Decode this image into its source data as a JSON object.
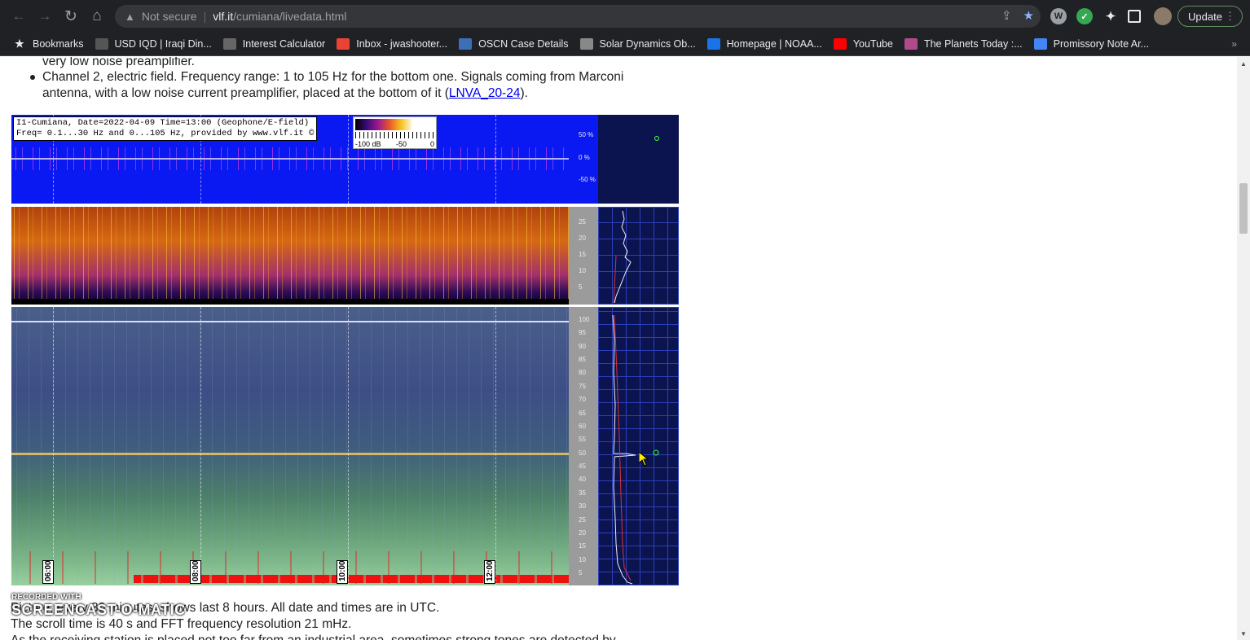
{
  "browser": {
    "nav": {
      "back": "←",
      "forward": "→",
      "reload": "↻",
      "home": "⌂"
    },
    "omnibox": {
      "security": "Not secure",
      "host": "vlf.it",
      "path": "/cumiana/livedata.html"
    },
    "update_label": "Update",
    "bookmarks": [
      {
        "label": "Bookmarks",
        "icon": "star-icon",
        "color": "#e8eaed"
      },
      {
        "label": "USD IQD | Iraqi Din...",
        "icon": "inv-icon",
        "color": "#555"
      },
      {
        "label": "Interest Calculator",
        "icon": "calculator-icon",
        "color": "#666"
      },
      {
        "label": "Inbox - jwashooter...",
        "icon": "gmail-icon",
        "color": "#ea4335"
      },
      {
        "label": "OSCN Case Details",
        "icon": "shield-icon",
        "color": "#3b6fb6"
      },
      {
        "label": "Solar Dynamics Ob...",
        "icon": "sdo-icon",
        "color": "#888"
      },
      {
        "label": "Homepage | NOAA...",
        "icon": "noaa-icon",
        "color": "#1a73e8"
      },
      {
        "label": "YouTube",
        "icon": "youtube-icon",
        "color": "#ff0000"
      },
      {
        "label": "The Planets Today :...",
        "icon": "planets-icon",
        "color": "#b04a8a"
      },
      {
        "label": "Promissory Note Ar...",
        "icon": "document-icon",
        "color": "#4285f4"
      }
    ]
  },
  "content": {
    "line_top": "very low noise preamplifier.",
    "bullet_line1": "Channel 2, electric field. Frequency range: 1 to 105 Hz for the bottom one. Signals coming from Marconi",
    "bullet_line2_pre": "antenna, with a low noise current preamplifier, placed at the bottom of it  (",
    "bullet_link": "LNVA_20-24",
    "bullet_line2_post": ").",
    "figure": {
      "info_line1": "I1-Cumiana, Date=2022-04-09 Time=13:00 (Geophone/E-field)",
      "info_line2": "Freq= 0.1...30 Hz and 0...105 Hz, provided by www.vlf.it ©",
      "scale_labels": [
        "-100 dB",
        "-50",
        "0"
      ],
      "wave_ticks": [
        "50 %",
        "0 %",
        "-50 %"
      ],
      "spec1_ticks": [
        "25",
        "20",
        "15",
        "10",
        "5"
      ],
      "spec2_ticks": [
        "100",
        "95",
        "90",
        "85",
        "80",
        "75",
        "70",
        "65",
        "60",
        "55",
        "50",
        "45",
        "40",
        "35",
        "30",
        "25",
        "20",
        "15",
        "10",
        "5"
      ],
      "time_labels": [
        "06:00",
        "08:00",
        "10:00",
        "12:00"
      ]
    },
    "para1": "Picture, every 30 minutes, shows last 8 hours. All date and times are in UTC.",
    "para2": "The scroll time is 40 s and FFT frequency resolution 21 mHz.",
    "para3": "As the receiving station is placed not too far from an industrial area, sometimes strong tones are detected by"
  },
  "watermark": {
    "line1": "RECORDED WITH",
    "line2": "SCREENCAST-O-MATIC"
  }
}
